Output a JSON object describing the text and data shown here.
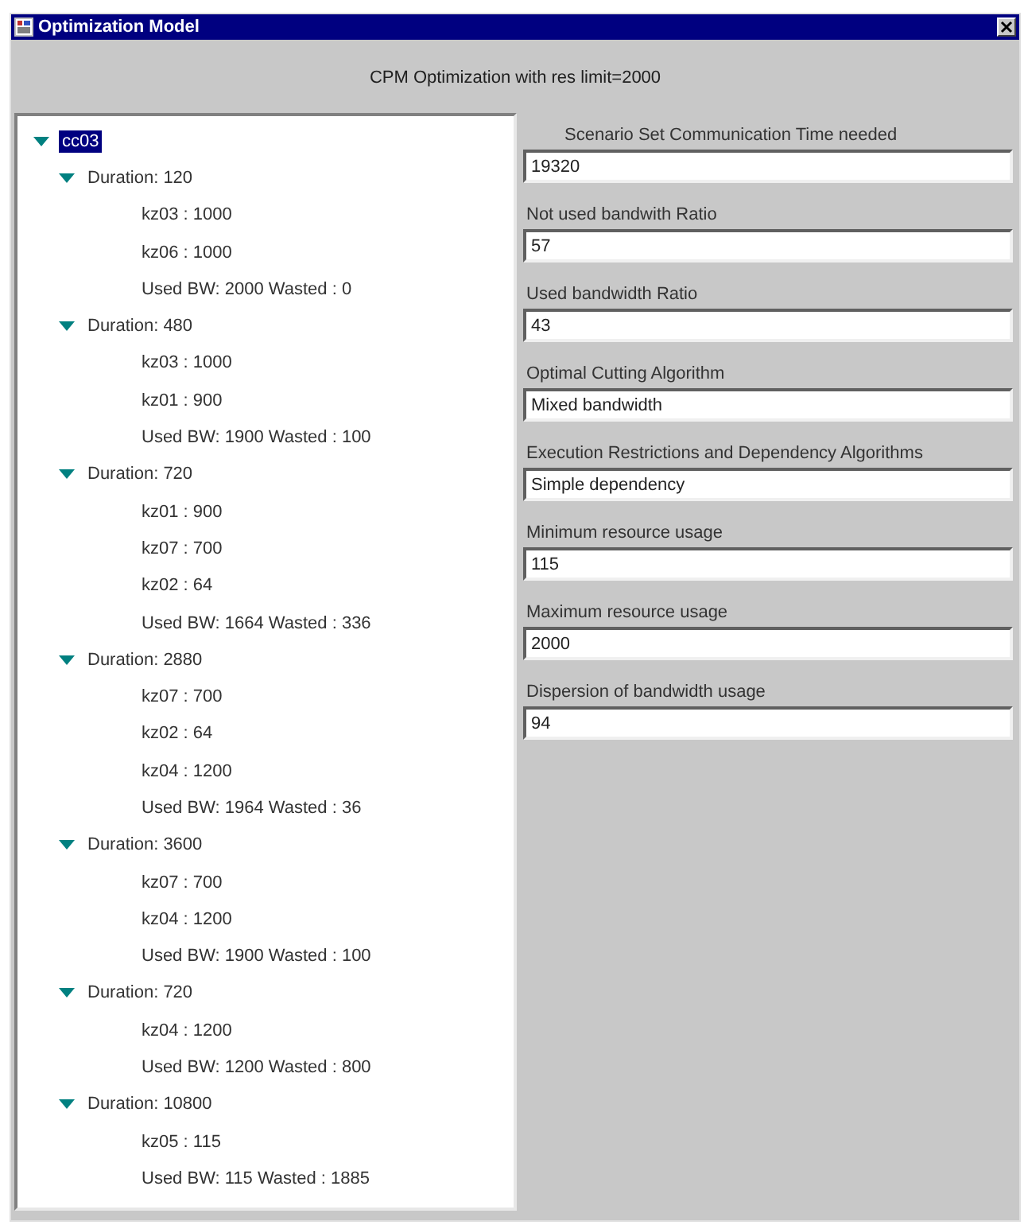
{
  "window": {
    "title": "Optimization Model"
  },
  "header": "CPM Optimization with res limit=2000",
  "tree": {
    "label": "cc03",
    "selected": true,
    "expanded": true,
    "children": [
      {
        "label": "Duration: 120",
        "expanded": true,
        "children": [
          {
            "label": "kz03 : 1000"
          },
          {
            "label": "kz06 : 1000"
          },
          {
            "label": "Used BW: 2000 Wasted : 0"
          }
        ]
      },
      {
        "label": "Duration: 480",
        "expanded": true,
        "children": [
          {
            "label": "kz03 : 1000"
          },
          {
            "label": "kz01 : 900"
          },
          {
            "label": "Used BW: 1900 Wasted : 100"
          }
        ]
      },
      {
        "label": "Duration: 720",
        "expanded": true,
        "children": [
          {
            "label": "kz01 : 900"
          },
          {
            "label": "kz07 : 700"
          },
          {
            "label": "kz02 : 64"
          },
          {
            "label": "Used BW: 1664 Wasted : 336"
          }
        ]
      },
      {
        "label": "Duration: 2880",
        "expanded": true,
        "children": [
          {
            "label": "kz07 : 700"
          },
          {
            "label": "kz02 : 64"
          },
          {
            "label": "kz04 : 1200"
          },
          {
            "label": "Used BW: 1964 Wasted : 36"
          }
        ]
      },
      {
        "label": "Duration: 3600",
        "expanded": true,
        "children": [
          {
            "label": "kz07 : 700"
          },
          {
            "label": "kz04 : 1200"
          },
          {
            "label": "Used BW: 1900 Wasted : 100"
          }
        ]
      },
      {
        "label": "Duration: 720",
        "expanded": true,
        "children": [
          {
            "label": "kz04 : 1200"
          },
          {
            "label": "Used BW: 1200 Wasted : 800"
          }
        ]
      },
      {
        "label": "Duration: 10800",
        "expanded": true,
        "children": [
          {
            "label": "kz05 : 115"
          },
          {
            "label": "Used BW: 115 Wasted : 1885"
          }
        ]
      }
    ]
  },
  "fields": [
    {
      "label": "Scenario Set Communication Time needed",
      "value": "19320"
    },
    {
      "label": "Not used bandwith Ratio",
      "value": "57"
    },
    {
      "label": "Used bandwidth Ratio",
      "value": "43"
    },
    {
      "label": "Optimal Cutting Algorithm",
      "value": "Mixed bandwidth"
    },
    {
      "label": "Execution Restrictions and Dependency Algorithms",
      "value": "Simple dependency"
    },
    {
      "label": "Minimum resource usage",
      "value": "115"
    },
    {
      "label": "Maximum resource usage",
      "value": "2000"
    },
    {
      "label": "Dispersion of bandwidth usage",
      "value": "94"
    }
  ]
}
